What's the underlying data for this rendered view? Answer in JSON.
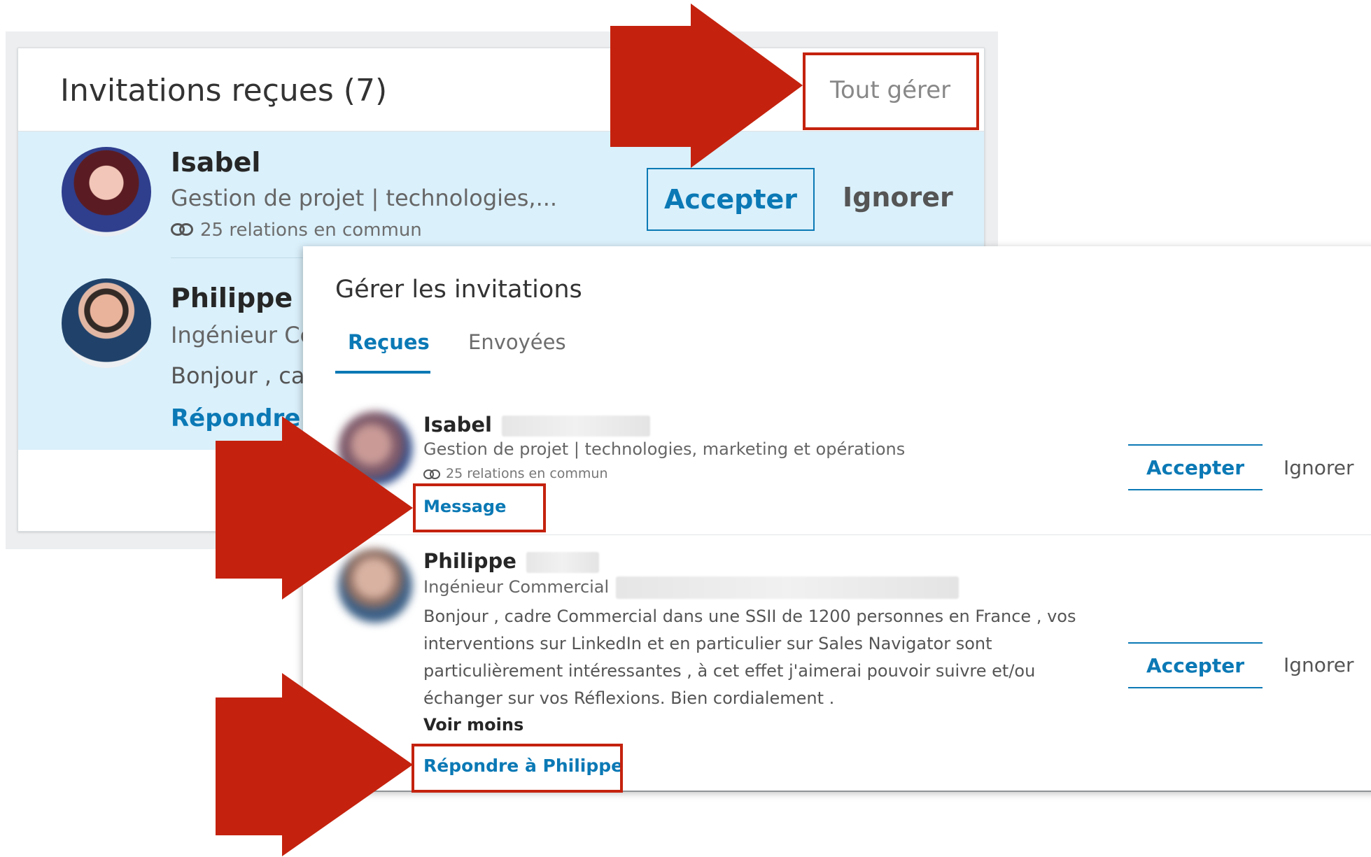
{
  "back_card": {
    "title": "Invitations reçues (7)",
    "manage_link": "Tout gérer",
    "invitations": [
      {
        "name": "Isabel",
        "headline": "Gestion de projet | technologies,...",
        "mutual": "25 relations en commun",
        "accept_label": "Accepter",
        "ignore_label": "Ignorer"
      },
      {
        "name": "Philippe",
        "headline": "Ingénieur Cc",
        "message_preview": "Bonjour , cac",
        "reply_label": "Répondre à"
      }
    ]
  },
  "dialog": {
    "title": "Gérer les invitations",
    "tabs": [
      {
        "label": "Reçues",
        "active": true
      },
      {
        "label": "Envoyées",
        "active": false
      }
    ],
    "invitations": [
      {
        "name": "Isabel",
        "headline": "Gestion de projet | technologies, marketing et opérations",
        "mutual": "25 relations en commun",
        "message_label": "Message",
        "accept_label": "Accepter",
        "ignore_label": "Ignorer"
      },
      {
        "name": "Philippe",
        "headline": "Ingénieur Commercial",
        "message": "Bonjour , cadre Commercial dans une SSII de 1200 personnes en France , vos interventions sur LinkedIn et en particulier sur Sales Navigator sont particulièrement intéressantes , à cet effet j'aimerai pouvoir suivre et/ou échanger sur vos Réflexions. Bien cordialement .",
        "see_less_label": "Voir moins",
        "reply_label": "Répondre à Philippe",
        "accept_label": "Accepter",
        "ignore_label": "Ignorer"
      }
    ]
  },
  "colors": {
    "accent": "#0b79b5",
    "highlight_red": "#c4220e",
    "row_highlight": "#daf0fb"
  },
  "icons": [
    "connections-icon",
    "right-arrow-icon"
  ]
}
